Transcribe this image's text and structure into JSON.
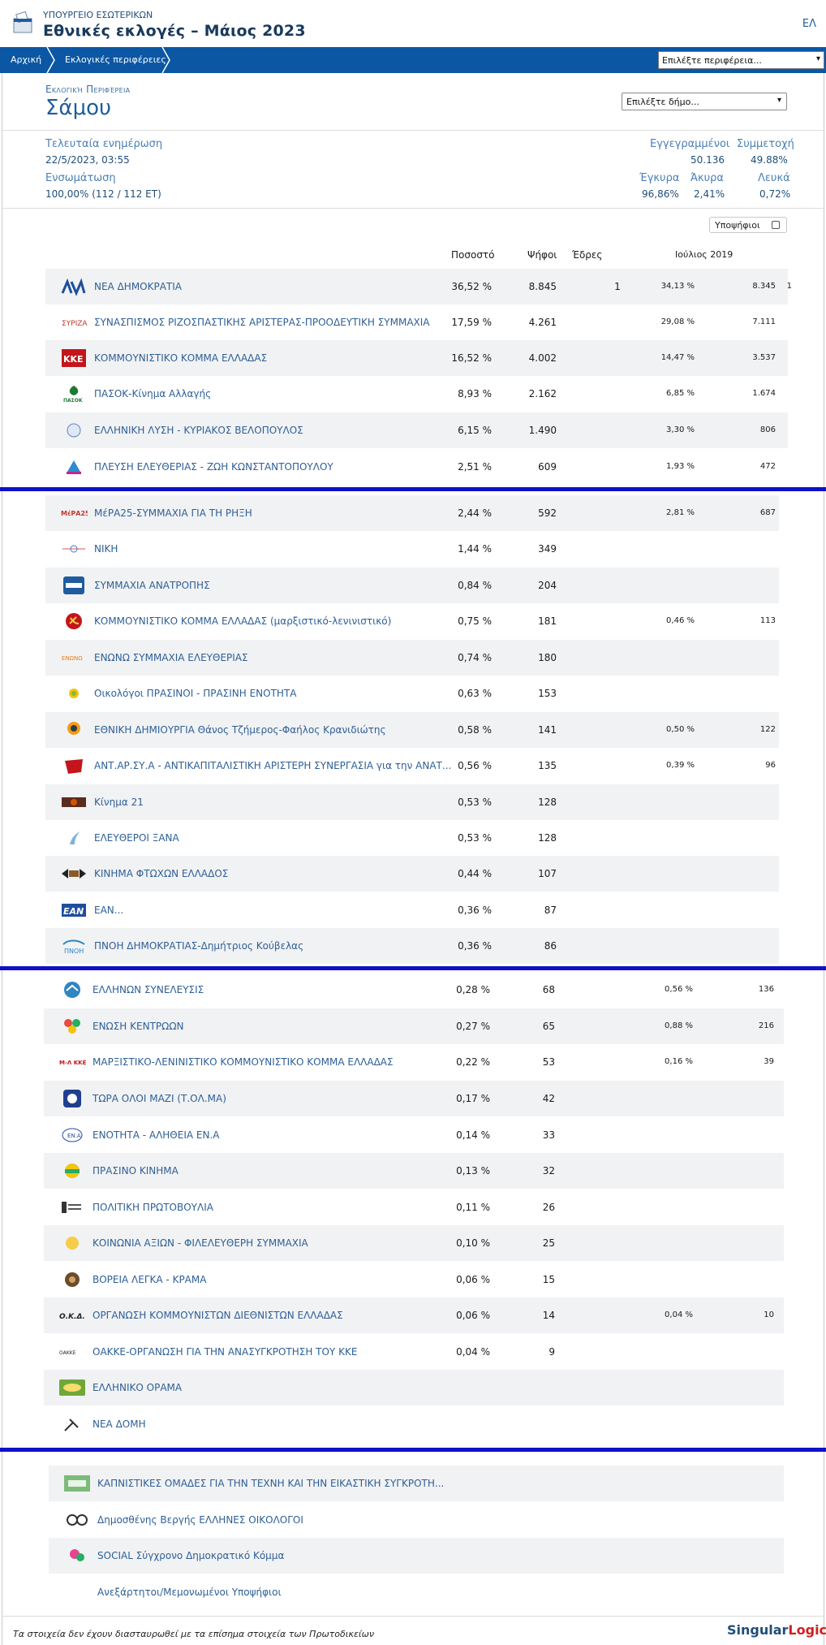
{
  "header": {
    "ministry": "ΥΠΟΥΡΓΕΙΟ ΕΣΩΤΕΡΙΚΩΝ",
    "title": "Εθνικές εκλογές – Μάιος 2023",
    "lang": "ΕΛ"
  },
  "nav": {
    "home": "Αρχική",
    "regions": "Εκλογικές περιφέρειες",
    "region_select": "Επιλέξτε περιφέρεια..."
  },
  "area": {
    "label": "Εκλογική Περιφέρεια",
    "name": "Σάμου",
    "muni_select": "Επιλέξτε δήμο..."
  },
  "stats": {
    "last_update_label": "Τελευταία ενημέρωση",
    "last_update": "22/5/2023, 03:55",
    "integration_label": "Ενσωμάτωση",
    "integration": "100,00% (112 / 112 ΕΤ)",
    "registered_label": "Εγγεγραμμένοι",
    "registered": "50.136",
    "turnout_label": "Συμμετοχή",
    "turnout": "49.88%",
    "valid_label": "Έγκυρα",
    "valid": "96,86%",
    "invalid_label": "Άκυρα",
    "invalid": "2,41%",
    "blank_label": "Λευκά",
    "blank": "0,72%"
  },
  "candidates_toggle": "Υποψήφιοι",
  "columns": {
    "percent": "Ποσοστό",
    "votes": "Ψήφοι",
    "seats": "Έδρες",
    "prev": "Ιούλιος 2019"
  },
  "accent": "#0b57a4",
  "divider_color": "#1010c8",
  "parties": [
    {
      "name": "ΝΕΑ ΔΗΜΟΚΡΑΤΙΑ",
      "pct": "36,52 %",
      "votes": "8.845",
      "seats": "1",
      "prev_pct": "34,13 %",
      "prev_votes": "8.345",
      "prev_seats": "1",
      "icon": "nd-logo"
    },
    {
      "name": "ΣΥΝΑΣΠΙΣΜΟΣ ΡΙΖΟΣΠΑΣΤΙΚΗΣ ΑΡΙΣΤΕΡΑΣ-ΠΡΟΟΔΕΥΤΙΚΗ ΣΥΜΜΑΧΙΑ",
      "pct": "17,59 %",
      "votes": "4.261",
      "seats": "",
      "prev_pct": "29,08 %",
      "prev_votes": "7.111",
      "prev_seats": "",
      "icon": "syriza-logo"
    },
    {
      "name": "ΚΟΜΜΟΥΝΙΣΤΙΚΟ ΚΟΜΜΑ ΕΛΛΑΔΑΣ",
      "pct": "16,52 %",
      "votes": "4.002",
      "seats": "",
      "prev_pct": "14,47 %",
      "prev_votes": "3.537",
      "prev_seats": "",
      "icon": "kke-logo"
    },
    {
      "name": "ΠΑΣΟΚ-Κίνημα Αλλαγής",
      "pct": "8,93 %",
      "votes": "2.162",
      "seats": "",
      "prev_pct": "6,85 %",
      "prev_votes": "1.674",
      "prev_seats": "",
      "icon": "pasok-logo"
    },
    {
      "name": "ΕΛΛΗΝΙΚΗ ΛΥΣΗ - ΚΥΡΙΑΚΟΣ ΒΕΛΟΠΟΥΛΟΣ",
      "pct": "6,15 %",
      "votes": "1.490",
      "seats": "",
      "prev_pct": "3,30 %",
      "prev_votes": "806",
      "prev_seats": "",
      "icon": "elliniki-lysi-logo"
    },
    {
      "name": "ΠΛΕΥΣΗ ΕΛΕΥΘΕΡΙΑΣ - ΖΩΗ ΚΩΝΣΤΑΝΤΟΠΟΥΛΟΥ",
      "pct": "2,51 %",
      "votes": "609",
      "seats": "",
      "prev_pct": "1,93 %",
      "prev_votes": "472",
      "prev_seats": "",
      "icon": "plefsi-logo"
    },
    {
      "name": "ΜέΡΑ25-ΣΥΜΜΑΧΙΑ ΓΙΑ ΤΗ ΡΗΞΗ",
      "pct": "2,44 %",
      "votes": "592",
      "seats": "",
      "prev_pct": "2,81 %",
      "prev_votes": "687",
      "prev_seats": "",
      "icon": "mera25-logo"
    },
    {
      "name": "ΝΙΚΗ",
      "pct": "1,44 %",
      "votes": "349",
      "seats": "",
      "prev_pct": "",
      "prev_votes": "",
      "prev_seats": "",
      "icon": "niki-logo"
    },
    {
      "name": "ΣΥΜΜΑΧΙΑ ΑΝΑΤΡΟΠΗΣ",
      "pct": "0,84 %",
      "votes": "204",
      "seats": "",
      "prev_pct": "",
      "prev_votes": "",
      "prev_seats": "",
      "icon": "anatropi-logo"
    },
    {
      "name": "ΚΟΜΜΟΥΝΙΣΤΙΚΟ ΚΟΜΜΑ ΕΛΛΑΔΑΣ (μαρξιστικό-λενινιστικό)",
      "pct": "0,75 %",
      "votes": "181",
      "seats": "",
      "prev_pct": "0,46 %",
      "prev_votes": "113",
      "prev_seats": "",
      "icon": "kke-ml-logo"
    },
    {
      "name": "ΕΝΩΝΩ ΣΥΜΜΑΧΙΑ ΕΛΕΥΘΕΡΙΑΣ",
      "pct": "0,74 %",
      "votes": "180",
      "seats": "",
      "prev_pct": "",
      "prev_votes": "",
      "prev_seats": "",
      "icon": "enono-logo"
    },
    {
      "name": "Οικολόγοι ΠΡΑΣΙΝΟΙ - ΠΡΑΣΙΝΗ ΕΝΟΤΗΤΑ",
      "pct": "0,63 %",
      "votes": "153",
      "seats": "",
      "prev_pct": "",
      "prev_votes": "",
      "prev_seats": "",
      "icon": "oikologoi-logo"
    },
    {
      "name": "ΕΘΝΙΚΗ ΔΗΜΙΟΥΡΓΙΑ Θάνος Τζήμερος-Φαήλος Κρανιδιώτης",
      "pct": "0,58 %",
      "votes": "141",
      "seats": "",
      "prev_pct": "0,50 %",
      "prev_votes": "122",
      "prev_seats": "",
      "icon": "ethniki-dimiourgia-logo"
    },
    {
      "name": "ΑΝΤ.ΑΡ.ΣΥ.Α - ΑΝΤΙΚΑΠΙΤΑΛΙΣΤΙΚΗ ΑΡΙΣΤΕΡΗ ΣΥΝΕΡΓΑΣΙΑ για την ΑΝΑΤ...",
      "pct": "0,56 %",
      "votes": "135",
      "seats": "",
      "prev_pct": "0,39 %",
      "prev_votes": "96",
      "prev_seats": "",
      "icon": "antarsya-logo"
    },
    {
      "name": "Κίνημα 21",
      "pct": "0,53 %",
      "votes": "128",
      "seats": "",
      "prev_pct": "",
      "prev_votes": "",
      "prev_seats": "",
      "icon": "kinima21-logo"
    },
    {
      "name": "ΕΛΕΥΘΕΡΟΙ ΞΑΝΑ",
      "pct": "0,53 %",
      "votes": "128",
      "seats": "",
      "prev_pct": "",
      "prev_votes": "",
      "prev_seats": "",
      "icon": "eleftheroi-xana-logo"
    },
    {
      "name": "ΚΙΝΗΜΑ ΦΤΩΧΩΝ ΕΛΛΑΔΟΣ",
      "pct": "0,44 %",
      "votes": "107",
      "seats": "",
      "prev_pct": "",
      "prev_votes": "",
      "prev_seats": "",
      "icon": "ftoxon-logo"
    },
    {
      "name": "ΕΑΝ...",
      "pct": "0,36 %",
      "votes": "87",
      "seats": "",
      "prev_pct": "",
      "prev_votes": "",
      "prev_seats": "",
      "icon": "ean-logo"
    },
    {
      "name": "ΠΝΟΗ ΔΗΜΟΚΡΑΤΙΑΣ-Δημήτριος Κούβελας",
      "pct": "0,36 %",
      "votes": "86",
      "seats": "",
      "prev_pct": "",
      "prev_votes": "",
      "prev_seats": "",
      "icon": "pnoi-logo"
    },
    {
      "name": "ΕΛΛΗΝΩΝ ΣΥΝΕΛΕΥΣΙΣ",
      "pct": "0,28 %",
      "votes": "68",
      "seats": "",
      "prev_pct": "0,56 %",
      "prev_votes": "136",
      "prev_seats": "",
      "icon": "synelefsis-logo"
    },
    {
      "name": "ΕΝΩΣΗ ΚΕΝΤΡΩΩΝ",
      "pct": "0,27 %",
      "votes": "65",
      "seats": "",
      "prev_pct": "0,88 %",
      "prev_votes": "216",
      "prev_seats": "",
      "icon": "kentroon-logo"
    },
    {
      "name": "ΜΑΡΞΙΣΤΙΚΟ-ΛΕΝΙΝΙΣΤΙΚΟ ΚΟΜΜΟΥΝΙΣΤΙΚΟ ΚΟΜΜΑ ΕΛΛΑΔΑΣ",
      "pct": "0,22 %",
      "votes": "53",
      "seats": "",
      "prev_pct": "0,16 %",
      "prev_votes": "39",
      "prev_seats": "",
      "icon": "m-l-kke-logo"
    },
    {
      "name": "ΤΩΡΑ ΟΛΟΙ ΜΑΖΙ (Τ.ΟΛ.ΜΑ)",
      "pct": "0,17 %",
      "votes": "42",
      "seats": "",
      "prev_pct": "",
      "prev_votes": "",
      "prev_seats": "",
      "icon": "tolma-logo"
    },
    {
      "name": "ΕΝΟΤΗΤΑ - ΑΛΗΘΕΙΑ ΕΝ.Α",
      "pct": "0,14 %",
      "votes": "33",
      "seats": "",
      "prev_pct": "",
      "prev_votes": "",
      "prev_seats": "",
      "icon": "ena-logo"
    },
    {
      "name": "ΠΡΑΣΙΝΟ ΚΙΝΗΜΑ",
      "pct": "0,13 %",
      "votes": "32",
      "seats": "",
      "prev_pct": "",
      "prev_votes": "",
      "prev_seats": "",
      "icon": "prasino-kinima-logo"
    },
    {
      "name": "ΠΟΛΙΤΙΚΗ ΠΡΩΤΟΒΟΥΛΙΑ",
      "pct": "0,11 %",
      "votes": "26",
      "seats": "",
      "prev_pct": "",
      "prev_votes": "",
      "prev_seats": "",
      "icon": "politiki-protovoulia-logo"
    },
    {
      "name": "ΚΟΙΝΩΝΙΑ ΑΞΙΩΝ - ΦΙΛΕΛΕΥΘΕΡΗ ΣΥΜΜΑΧΙΑ",
      "pct": "0,10 %",
      "votes": "25",
      "seats": "",
      "prev_pct": "",
      "prev_votes": "",
      "prev_seats": "",
      "icon": "koinonia-axion-logo"
    },
    {
      "name": "ΒΟΡΕΙΑ ΛΕΓΚΑ - ΚΡΑΜΑ",
      "pct": "0,06 %",
      "votes": "15",
      "seats": "",
      "prev_pct": "",
      "prev_votes": "",
      "prev_seats": "",
      "icon": "kramα-logo"
    },
    {
      "name": "ΟΡΓΑΝΩΣΗ ΚΟΜΜΟΥΝΙΣΤΩΝ ΔΙΕΘΝΙΣΤΩΝ ΕΛΛΑΔΑΣ",
      "pct": "0,06 %",
      "votes": "14",
      "seats": "",
      "prev_pct": "0,04 %",
      "prev_votes": "10",
      "prev_seats": "",
      "icon": "oked-logo"
    },
    {
      "name": "ΟΑΚΚΕ-ΟΡΓΑΝΩΣΗ ΓΙΑ ΤΗΝ ΑΝΑΣΥΓΚΡΟΤΗΣΗ ΤΟΥ ΚΚΕ",
      "pct": "0,04 %",
      "votes": "9",
      "seats": "",
      "prev_pct": "",
      "prev_votes": "",
      "prev_seats": "",
      "icon": "oakke-logo"
    },
    {
      "name": "ΕΛΛΗΝΙΚΟ ΟΡΑΜΑ",
      "pct": "",
      "votes": "",
      "seats": "",
      "prev_pct": "",
      "prev_votes": "",
      "prev_seats": "",
      "icon": "elliniko-orama-logo"
    },
    {
      "name": "ΝΕΑ ΔΟΜΗ",
      "pct": "",
      "votes": "",
      "seats": "",
      "prev_pct": "",
      "prev_votes": "",
      "prev_seats": "",
      "icon": "nea-domi-logo"
    },
    {
      "name": "ΚΑΠΝΙΣΤΙΚΕΣ ΟΜΑΔΕΣ ΓΙΑ ΤΗΝ ΤΕΧΝΗ ΚΑΙ ΤΗΝ ΕΙΚΑΣΤΙΚΗ ΣΥΓΚΡΟΤΗ...",
      "pct": "",
      "votes": "",
      "seats": "",
      "prev_pct": "",
      "prev_votes": "",
      "prev_seats": "",
      "icon": "kapnistikes-logo"
    },
    {
      "name": "Δημοσθένης Βεργής ΕΛΛΗΝΕΣ ΟΙΚΟΛΟΓΟΙ",
      "pct": "",
      "votes": "",
      "seats": "",
      "prev_pct": "",
      "prev_votes": "",
      "prev_seats": "",
      "icon": "ellines-oikologoi-logo"
    },
    {
      "name": "SOCIAL Σύγχρονο Δημοκρατικό Κόμμα",
      "pct": "",
      "votes": "",
      "seats": "",
      "prev_pct": "",
      "prev_votes": "",
      "prev_seats": "",
      "icon": "social-logo"
    },
    {
      "name": "Ανεξάρτητοι/Μεμονωμένοι Υποψήφιοι",
      "pct": "",
      "votes": "",
      "seats": "",
      "prev_pct": "",
      "prev_votes": "",
      "prev_seats": "",
      "icon": ""
    }
  ],
  "footer": {
    "note": "Τα στοιχεία δεν έχουν διασταυρωθεί με τα επίσημα στοιχεία των Πρωτοδικείων",
    "brand_main": "Singular",
    "brand_accent": "Logic"
  }
}
